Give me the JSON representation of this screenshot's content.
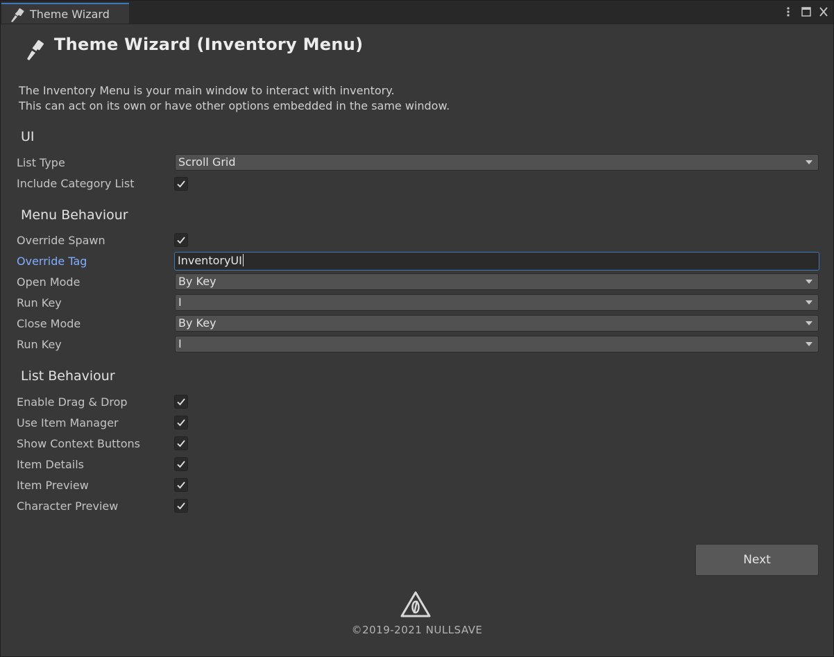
{
  "tab": {
    "label": "Theme Wizard",
    "icon": "brush-icon"
  },
  "window_controls": {
    "menu_icon": "kebab-menu-icon",
    "maximize_icon": "maximize-icon",
    "close_icon": "close-icon"
  },
  "header": {
    "title": "Theme Wizard (Inventory Menu)",
    "icon": "brush-icon",
    "description_line1": "The Inventory Menu is your main window to interact with inventory.",
    "description_line2": "This can act on its own or have other options embedded in the same window."
  },
  "ui_section": {
    "title": "UI",
    "list_type_label": "List Type",
    "list_type_value": "Scroll Grid",
    "include_category_label": "Include Category List",
    "include_category_checked": true
  },
  "menu_behaviour": {
    "title": "Menu Behaviour",
    "override_spawn_label": "Override Spawn",
    "override_spawn_checked": true,
    "override_tag_label": "Override Tag",
    "override_tag_value": "InventoryUI",
    "open_mode_label": "Open Mode",
    "open_mode_value": "By Key",
    "open_run_key_label": "Run Key",
    "open_run_key_value": "I",
    "close_mode_label": "Close Mode",
    "close_mode_value": "By Key",
    "close_run_key_label": "Run Key",
    "close_run_key_value": "I"
  },
  "list_behaviour": {
    "title": "List Behaviour",
    "items": [
      {
        "label": "Enable Drag & Drop",
        "checked": true
      },
      {
        "label": "Use Item Manager",
        "checked": true
      },
      {
        "label": "Show Context Buttons",
        "checked": true
      },
      {
        "label": "Item Details",
        "checked": true
      },
      {
        "label": "Item Preview",
        "checked": true
      },
      {
        "label": "Character Preview",
        "checked": true
      }
    ]
  },
  "footer": {
    "next_label": "Next",
    "logo_icon": "nullsave-logo-icon",
    "copyright": "©2019-2021 NULLSAVE"
  },
  "colors": {
    "background": "#383838",
    "accent": "#3a79bb",
    "focused_label": "#80adff"
  }
}
